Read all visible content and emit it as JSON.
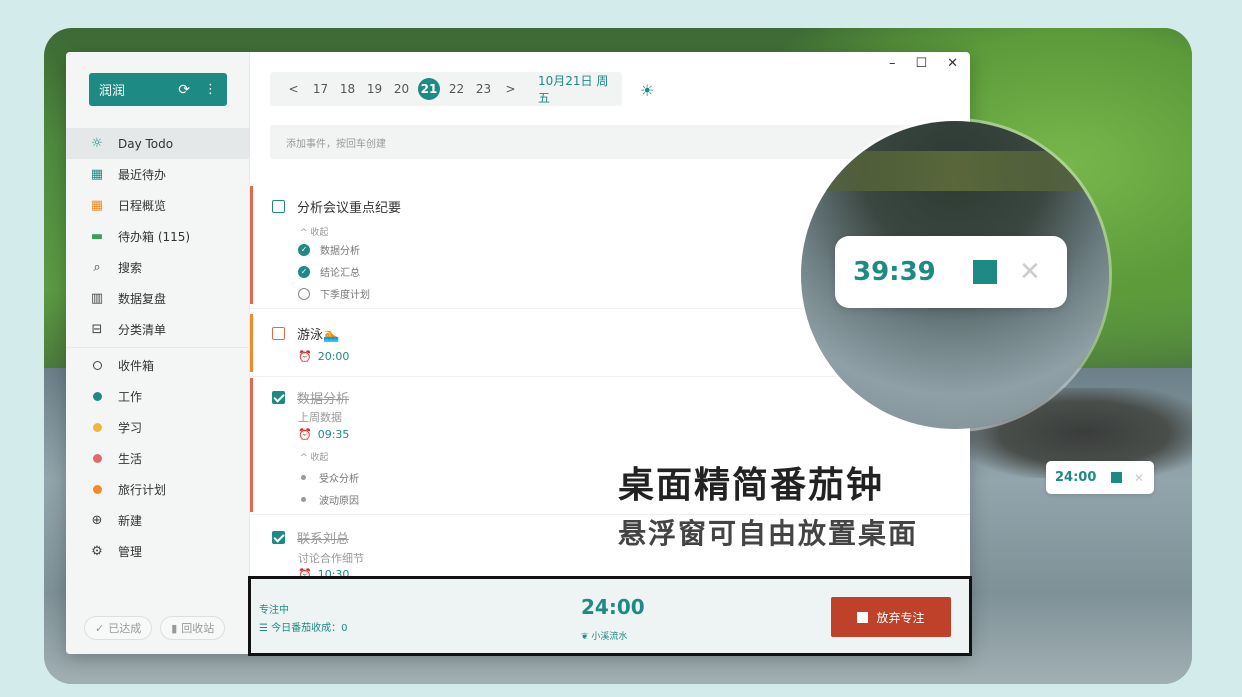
{
  "colors": {
    "accent": "#1e8a84",
    "danger": "#c0412a",
    "work": "#1e8a84",
    "study": "#f2b63a",
    "life": "#e06a6a",
    "travel": "#f28a2a"
  },
  "sidebar": {
    "user": {
      "name": "润润",
      "sync_icon": "sync-icon",
      "more_icon": "more-icon"
    },
    "items": [
      {
        "label": "Day Todo",
        "icon": "sun-icon"
      },
      {
        "label": "最近待办",
        "icon": "calendar-icon"
      },
      {
        "label": "日程概览",
        "icon": "schedule-icon"
      },
      {
        "label": "待办箱 (115)",
        "icon": "inbox-icon"
      },
      {
        "label": "搜索",
        "icon": "search-icon"
      },
      {
        "label": "数据复盘",
        "icon": "stats-icon"
      },
      {
        "label": "分类清单",
        "icon": "list-icon"
      }
    ],
    "lists": [
      {
        "label": "收件箱"
      },
      {
        "label": "工作"
      },
      {
        "label": "学习"
      },
      {
        "label": "生活"
      },
      {
        "label": "旅行计划"
      },
      {
        "label": "新建"
      },
      {
        "label": "管理"
      }
    ],
    "footer": {
      "done": "已达成",
      "trash": "回收站"
    }
  },
  "datebar": {
    "prev": "<",
    "next": ">",
    "days": [
      "17",
      "18",
      "19",
      "20",
      "21",
      "22",
      "23"
    ],
    "selected": "21",
    "full_date": "10月21日 周五"
  },
  "add_placeholder": "添加事件，按回车创建",
  "tasks": [
    {
      "title": "分析会议重点纪要",
      "collapse": "收起",
      "subs": [
        {
          "label": "数据分析",
          "done": true
        },
        {
          "label": "结论汇总",
          "done": true
        },
        {
          "label": "下季度计划",
          "done": false
        }
      ]
    },
    {
      "title": "游泳🏊",
      "time": "20:00"
    },
    {
      "title": "数据分析",
      "note": "上周数据",
      "time": "09:35",
      "collapse": "收起",
      "subs": [
        {
          "label": "受众分析"
        },
        {
          "label": "波动原因"
        }
      ]
    },
    {
      "title": "联系刘总",
      "note": "讨论合作细节",
      "time": "10:30"
    }
  ],
  "focus": {
    "status": "专注中",
    "count": "今日番茄收成：0",
    "timer": "24:00",
    "sound": "小溪流水",
    "give_up": "放弃专注"
  },
  "float_big": {
    "timer": "39:39"
  },
  "float_small": {
    "timer": "24:00"
  },
  "promo": {
    "title": "桌面精简番茄钟",
    "subtitle": "悬浮窗可自由放置桌面"
  },
  "window": {
    "minimize": "–",
    "maximize": "☐",
    "close": "✕"
  }
}
